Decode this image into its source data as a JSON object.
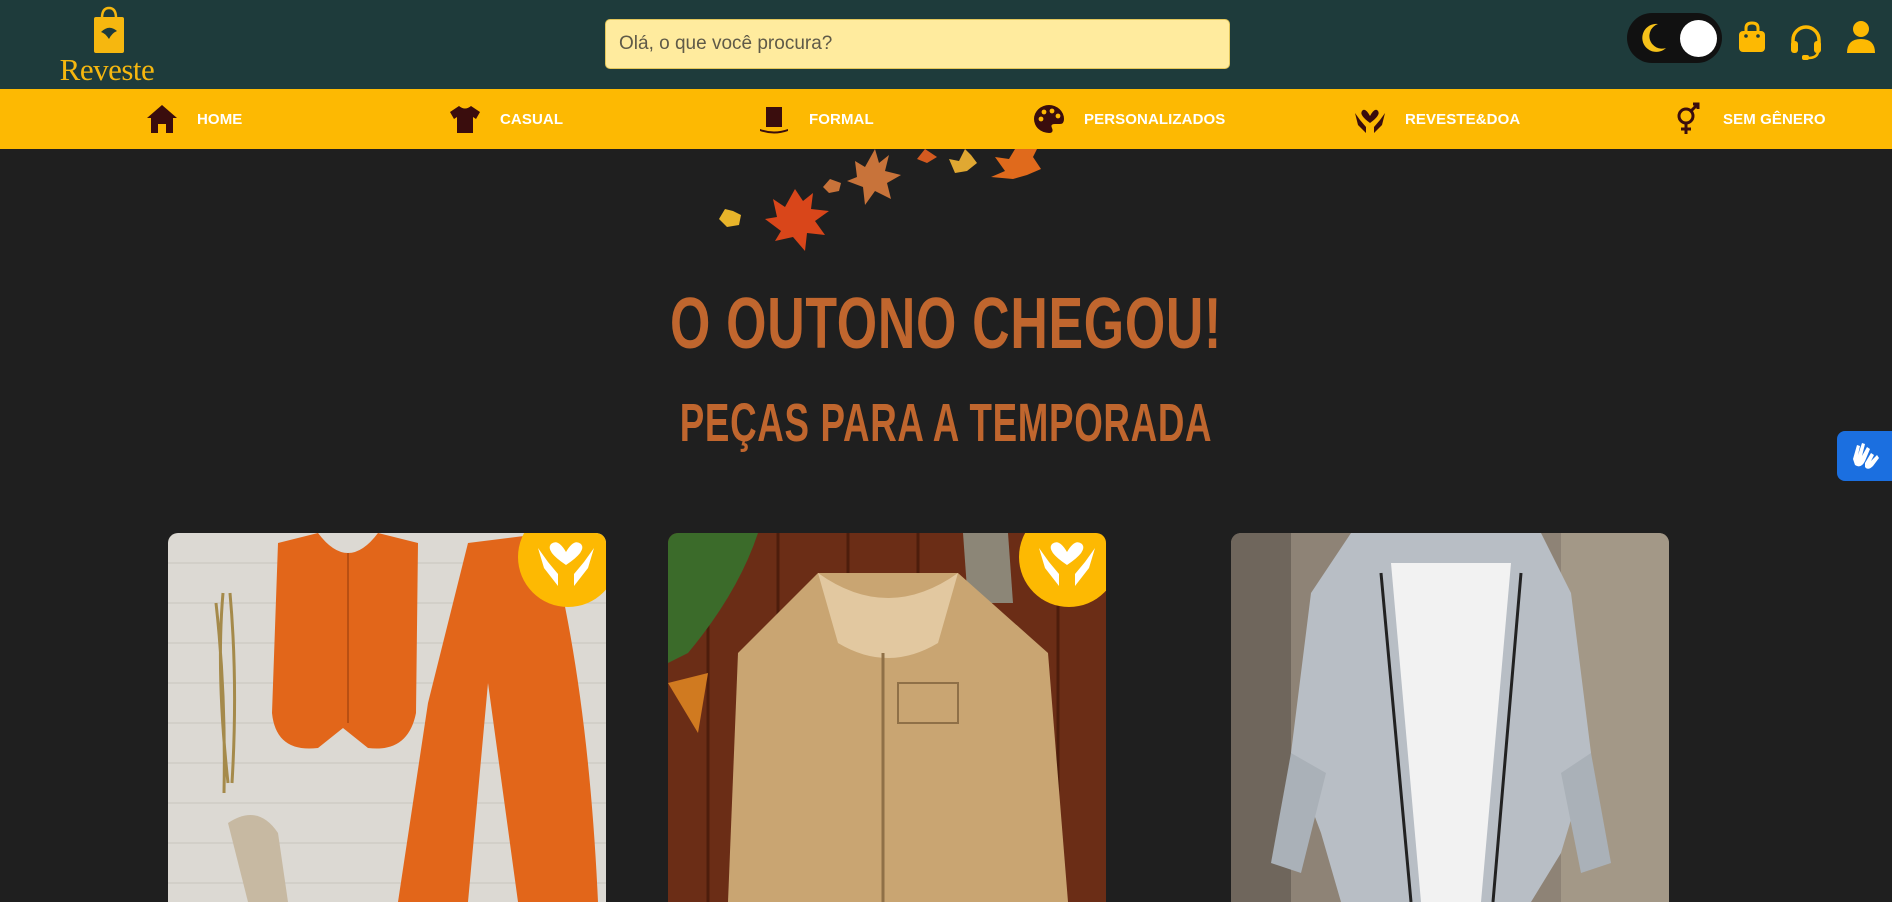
{
  "header": {
    "logo_text": "Reveste",
    "search_placeholder": "Olá, o que você procura?"
  },
  "nav": {
    "items": [
      {
        "label": "HOME",
        "icon": "home-icon"
      },
      {
        "label": "CASUAL",
        "icon": "shirt-icon"
      },
      {
        "label": "FORMAL",
        "icon": "top-hat-icon"
      },
      {
        "label": "PERSONALIZADOS",
        "icon": "palette-icon"
      },
      {
        "label": "REVESTE&DOA",
        "icon": "hands-heart-icon"
      },
      {
        "label": "SEM GÊNERO",
        "icon": "gender-icon"
      }
    ]
  },
  "hero": {
    "title": "O OUTONO CHEGOU!",
    "subtitle": "PEÇAS PARA A TEMPORADA"
  },
  "colors": {
    "header_bg": "#1e3b3b",
    "nav_bg": "#fdb902",
    "page_bg": "#1f1f1f",
    "hero_text": "#c0662e",
    "search_bg": "#ffeb9e"
  },
  "products": [
    {
      "item": "orange-vest-and-pants-set",
      "donation_badge": true
    },
    {
      "item": "beige-sherpa-jacket",
      "donation_badge": true
    },
    {
      "item": "grey-hooded-jacket",
      "donation_badge": false
    }
  ]
}
